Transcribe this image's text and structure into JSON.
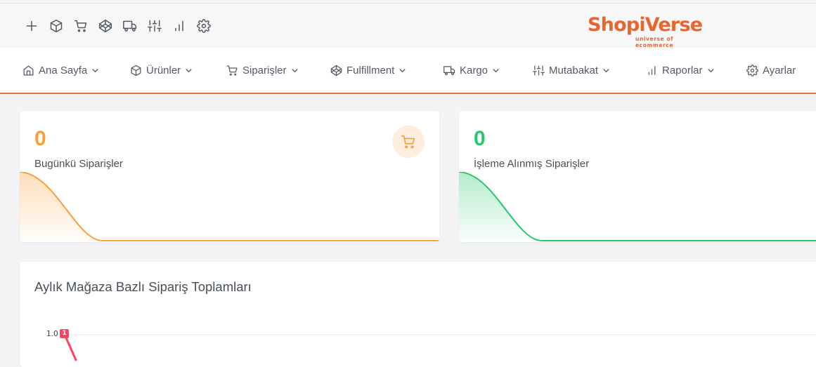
{
  "brand": {
    "name": "ShopiVerse",
    "tagline": "universe of ecommerce",
    "color": "#e8652d"
  },
  "topbar": {
    "icons": [
      "plus-icon",
      "box-icon",
      "cart-icon",
      "codepen-icon",
      "truck-icon",
      "sliders-icon",
      "bar-chart-icon",
      "settings-icon"
    ]
  },
  "nav": {
    "items": [
      {
        "label": "Ana Sayfa",
        "icon": "home-icon",
        "has_dropdown": true
      },
      {
        "label": "Ürünler",
        "icon": "box-icon",
        "has_dropdown": true
      },
      {
        "label": "Siparişler",
        "icon": "cart-icon",
        "has_dropdown": true
      },
      {
        "label": "Fulfillment",
        "icon": "codepen-icon",
        "has_dropdown": true
      },
      {
        "label": "Kargo",
        "icon": "truck-icon",
        "has_dropdown": true
      },
      {
        "label": "Mutabakat",
        "icon": "sliders-icon",
        "has_dropdown": true
      },
      {
        "label": "Raporlar",
        "icon": "bar-chart-icon",
        "has_dropdown": true
      },
      {
        "label": "Ayarlar",
        "icon": "settings-icon",
        "has_dropdown": false
      }
    ],
    "accent_color": "#e07634"
  },
  "stats": [
    {
      "value": "0",
      "label": "Bugünkü Siparişler",
      "color": "#f7a03c",
      "icon": "cart-icon"
    },
    {
      "value": "0",
      "label": "İşleme Alınmış Siparişler",
      "color": "#28c76f"
    }
  ],
  "monthly_chart": {
    "title": "Aylık Mağaza Bazlı Sipariş Toplamları",
    "y_tick_top": "1.0",
    "first_data_label": "1",
    "series_color": "#ff4560"
  },
  "chart_data": {
    "type": "line",
    "title": "Aylık Mağaza Bazlı Sipariş Toplamları",
    "ylim_top": 1.0,
    "series": [
      {
        "values": [
          1
        ]
      }
    ]
  }
}
